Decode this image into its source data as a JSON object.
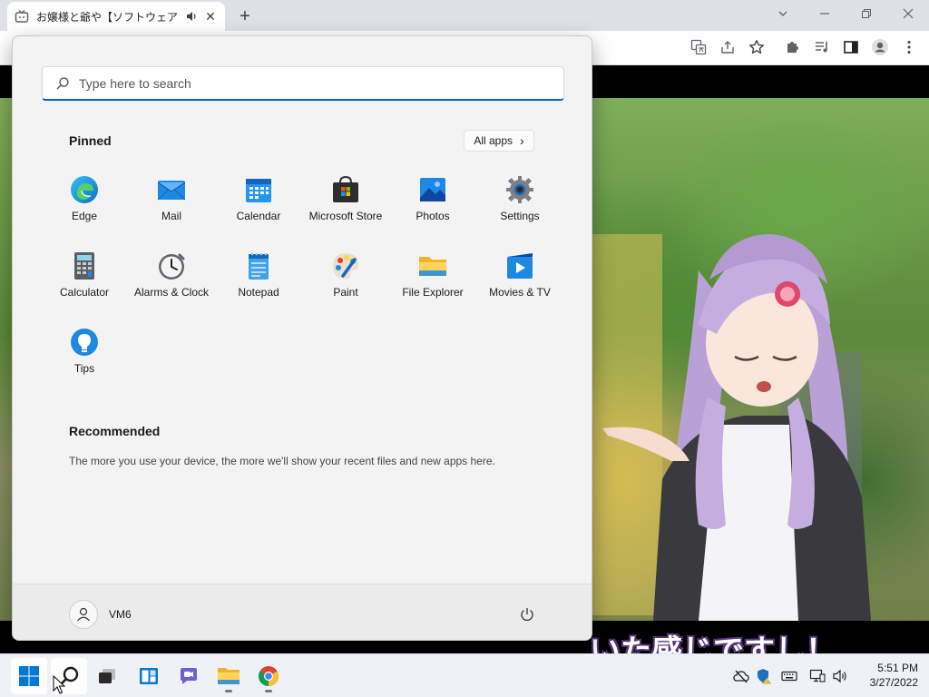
{
  "browser": {
    "tab_title": "お嬢様と爺や【ソフトウェアトーク劇",
    "tab_close": "✕",
    "new_tab": "+"
  },
  "video": {
    "subtitle": "いた感じですし！"
  },
  "start_menu": {
    "search_placeholder": "Type here to search",
    "pinned_title": "Pinned",
    "all_apps_label": "All apps",
    "all_apps_chevron": "›",
    "pinned_apps": [
      {
        "label": "Edge",
        "icon": "edge-icon"
      },
      {
        "label": "Mail",
        "icon": "mail-icon"
      },
      {
        "label": "Calendar",
        "icon": "calendar-icon"
      },
      {
        "label": "Microsoft Store",
        "icon": "store-icon"
      },
      {
        "label": "Photos",
        "icon": "photos-icon"
      },
      {
        "label": "Settings",
        "icon": "settings-icon"
      },
      {
        "label": "Calculator",
        "icon": "calculator-icon"
      },
      {
        "label": "Alarms & Clock",
        "icon": "clock-icon"
      },
      {
        "label": "Notepad",
        "icon": "notepad-icon"
      },
      {
        "label": "Paint",
        "icon": "paint-icon"
      },
      {
        "label": "File Explorer",
        "icon": "folder-icon"
      },
      {
        "label": "Movies & TV",
        "icon": "movies-icon"
      },
      {
        "label": "Tips",
        "icon": "tips-icon"
      }
    ],
    "recommended_title": "Recommended",
    "recommended_text": "The more you use your device, the more we'll show your recent files and new apps here.",
    "user_name": "VM6"
  },
  "taskbar": {
    "time": "5:51 PM",
    "date": "3/27/2022"
  },
  "colors": {
    "accent": "#0067c0",
    "start_bg": "#f3f3f3",
    "taskbar_bg": "#eef1f6"
  }
}
